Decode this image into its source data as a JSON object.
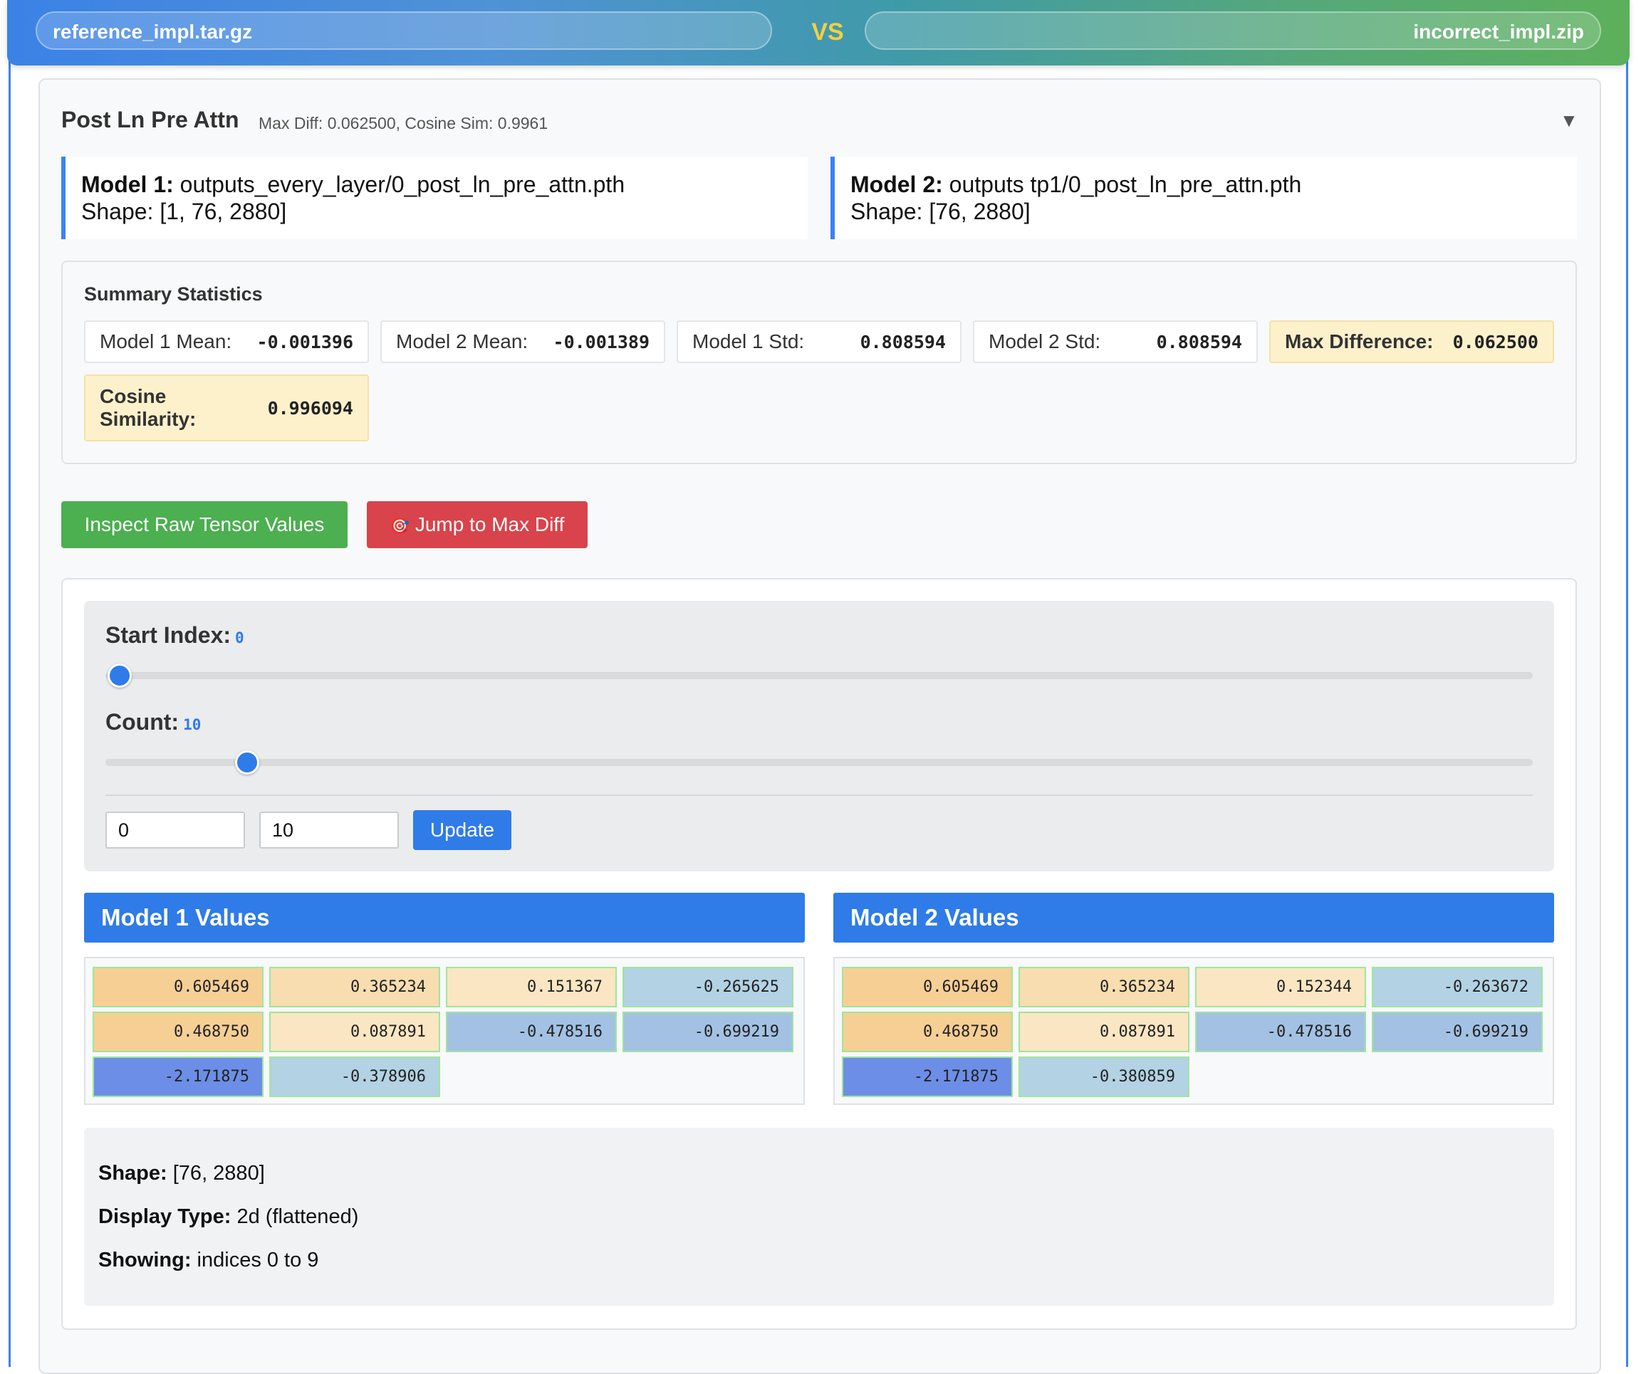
{
  "header": {
    "left_file": "reference_impl.tar.gz",
    "vs": "VS",
    "right_file": "incorrect_impl.zip"
  },
  "layer": {
    "title": "Post Ln Pre Attn",
    "meta": "Max Diff: 0.062500, Cosine Sim: 0.9961",
    "collapse_icon": "▼"
  },
  "model1": {
    "label": "Model 1:",
    "path": "outputs_every_layer/0_post_ln_pre_attn.pth",
    "shape_label": "Shape:",
    "shape": "[1, 76, 2880]"
  },
  "model2": {
    "label": "Model 2:",
    "path": "outputs tp1/0_post_ln_pre_attn.pth",
    "shape_label": "Shape:",
    "shape": "[76, 2880]"
  },
  "summary": {
    "title": "Summary Statistics",
    "model1_mean": {
      "label": "Model 1 Mean:",
      "value": "-0.001396"
    },
    "model2_mean": {
      "label": "Model 2 Mean:",
      "value": "-0.001389"
    },
    "model1_std": {
      "label": "Model 1 Std:",
      "value": "0.808594"
    },
    "model2_std": {
      "label": "Model 2 Std:",
      "value": "0.808594"
    },
    "max_diff": {
      "label": "Max Difference:",
      "value": "0.062500"
    },
    "cosine": {
      "label": "Cosine Similarity:",
      "value": "0.996094"
    }
  },
  "buttons": {
    "inspect": "Inspect Raw Tensor Values",
    "jump_icon": "🎯",
    "jump": "Jump to Max Diff",
    "update": "Update"
  },
  "controls": {
    "start_label": "Start Index:",
    "start_value": "0",
    "count_label": "Count:",
    "count_value": "10",
    "start_input": "0",
    "count_input": "10"
  },
  "values": {
    "model1_title": "Model 1 Values",
    "model2_title": "Model 2 Values",
    "model1": [
      "0.605469",
      "0.365234",
      "0.151367",
      "-0.265625",
      "0.468750",
      "0.087891",
      "-0.478516",
      "-0.699219",
      "-2.171875",
      "-0.378906"
    ],
    "model2": [
      "0.605469",
      "0.365234",
      "0.152344",
      "-0.263672",
      "0.468750",
      "0.087891",
      "-0.478516",
      "-0.699219",
      "-2.171875",
      "-0.380859"
    ]
  },
  "colors": {
    "accent": "#2f7be8",
    "green_button": "#4caf50",
    "red_button": "#d9434b",
    "vs": "#f4d03f"
  },
  "info": {
    "shape_label": "Shape:",
    "shape": "[76, 2880]",
    "display_label": "Display Type:",
    "display": "2d (flattened)",
    "showing_label": "Showing:",
    "showing": "indices 0 to 9"
  }
}
